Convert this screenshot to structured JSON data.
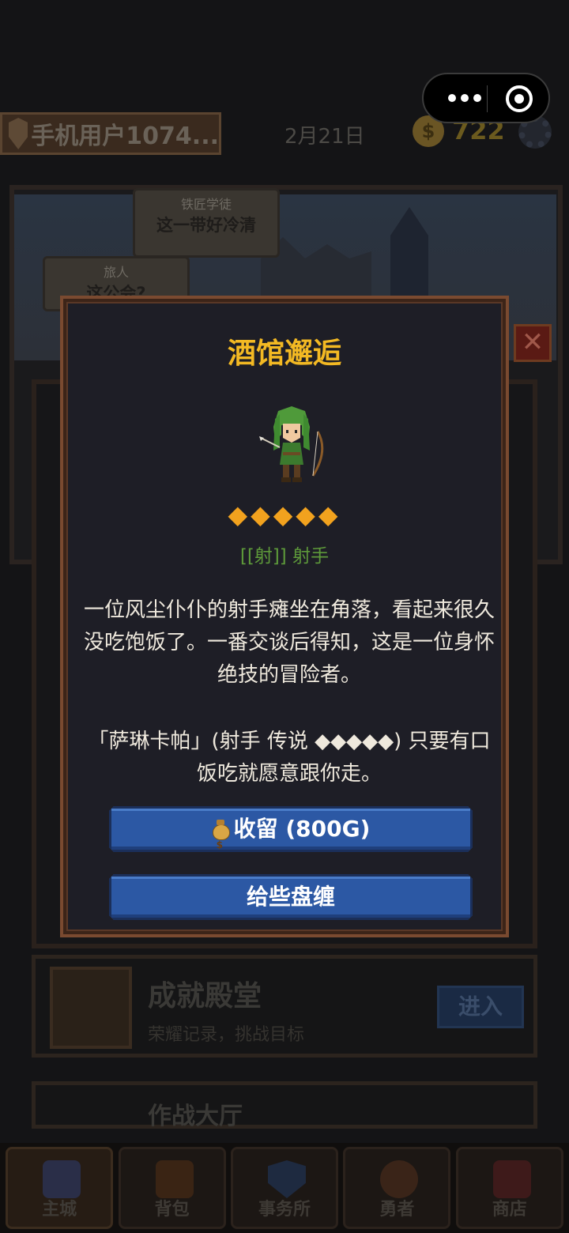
{
  "header": {
    "username": "手机用户1074...",
    "date": "2月21日",
    "gold": "722",
    "coin_symbol": "$"
  },
  "scene": {
    "bubbles": [
      {
        "speaker": "铁匠学徒",
        "text": "这一带好冷清"
      },
      {
        "speaker": "旅人",
        "text": "这公会?"
      }
    ],
    "side_close": "✕"
  },
  "cards": {
    "achievement": {
      "title": "成就殿堂",
      "subtitle": "荣耀记录，挑战目标",
      "button": "进入"
    },
    "war": {
      "title": "作战大厅"
    }
  },
  "bottom_nav": {
    "items": [
      {
        "label": "主城",
        "icon": "castle-icon",
        "active": true
      },
      {
        "label": "背包",
        "icon": "bag-icon",
        "active": false
      },
      {
        "label": "事务所",
        "icon": "shield-icon",
        "active": false
      },
      {
        "label": "勇者",
        "icon": "hero-icon",
        "active": false
      },
      {
        "label": "商店",
        "icon": "shop-icon",
        "active": false
      }
    ]
  },
  "modal": {
    "title": "酒馆邂逅",
    "rating": "◆◆◆◆◆",
    "class_tag": "[[射]] 射手",
    "story_1": "一位风尘仆仆的射手瘫坐在角落，看起来很久没吃饱饭了。一番交谈后得知，这是一位身怀绝技的冒险者。",
    "story_2": "「萨琳卡帕」(射手 传说 ◆◆◆◆◆) 只要有口饭吃就愿意跟你走。",
    "adopt_label": "收留 (800G)",
    "tip_label": "给些盘缠"
  },
  "colors": {
    "title_gold": "#f3b923",
    "star_orange": "#f2a21e",
    "class_green": "#5e9a3a",
    "button_blue": "#2c58a4"
  }
}
